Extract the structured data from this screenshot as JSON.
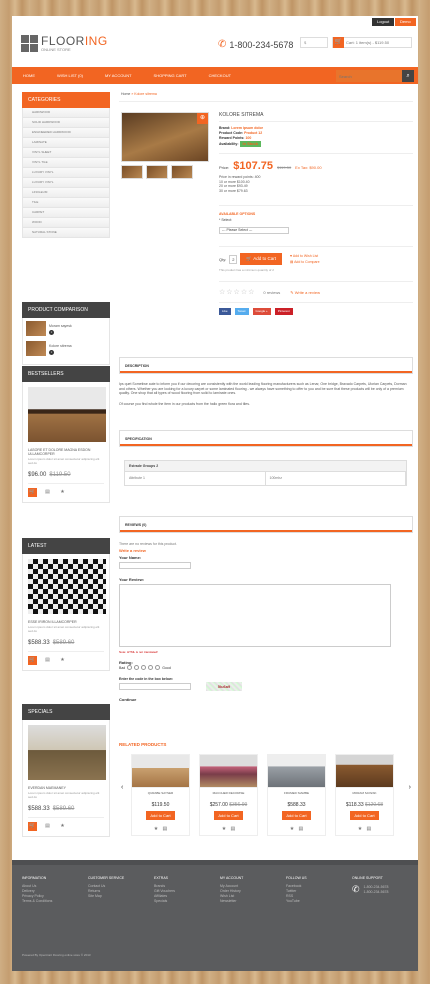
{
  "topbar": {
    "logout": "Logout",
    "demo": "Demo"
  },
  "header": {
    "logo_part1": "FLOOR",
    "logo_part2": "ING",
    "tagline": "ONLINE STORE",
    "phone": "1-800-234-5678",
    "currency": "$",
    "cart_text": "Cart: 1 item(s) - $119.50",
    "colors": {
      "accent": "#f26522",
      "dark": "#444444"
    }
  },
  "nav": {
    "items": [
      "Home",
      "Wish list (0)",
      "My account",
      "Shopping cart",
      "Checkout"
    ],
    "search_placeholder": "Search"
  },
  "sidebar": {
    "categories_title": "Categories",
    "categories": [
      "Hardwood",
      "Solid hardwood",
      "Engineered hardwood",
      "Laminate",
      "Vinyl sheet",
      "Vinyl tile",
      "Luxury vinyl",
      "Luxury vinyl",
      "Linoleum",
      "Tile",
      "Carpet",
      "Wood",
      "Natural stone"
    ],
    "compare_title": "Product comparison",
    "compare_items": [
      "Moram sayesk",
      "Kolore sitrema"
    ],
    "compare_button": "Product Compare",
    "bestsellers_title": "Bestsellers",
    "bestseller": {
      "name": "Lasore et dolore magna esdon ullamcorper",
      "desc": "Lorem ipsum dolor sit amet consectetur adipiscing elit sed do",
      "price": "$96.00",
      "old": "$119.50"
    },
    "latest_title": "Latest",
    "latest": {
      "name": "Esse iriron illamcorper",
      "desc": "Lorem ipsum dolor sit amet consectetur adipiscing elit sed do",
      "price": "$588.33",
      "old": "$589.60"
    },
    "specials_title": "Specials",
    "special": {
      "name": "Everdan Maemaney",
      "desc": "Lorem ipsum dolor sit amet consectetur adipiscing elit sed do",
      "price": "$588.33",
      "old": "$589.60"
    }
  },
  "breadcrumb": {
    "home": "Home",
    "sep": "»",
    "current": "Kolore sitrema"
  },
  "product": {
    "title": "Kolore sitrema",
    "brand_label": "Brand:",
    "brand": "Lorem ipsum dolor",
    "code_label": "Product Code:",
    "code": "Product 12",
    "reward_label": "Reward Points:",
    "reward": "100",
    "avail_label": "Availability:",
    "avail": "In Stock",
    "price_label": "Price:",
    "price": "$107.75",
    "old_price": "$119.50",
    "ex_tax": "Ex Tax: $90.00",
    "discounts": [
      "Price in reward points: 400",
      "10 or more $100.40",
      "20 or more $93.49",
      "30 or more $79.63"
    ],
    "options_title": "Available Options",
    "select_label": "* Select:",
    "select_value": "--- Please Select ---",
    "qty_label": "Qty:",
    "qty": "2",
    "add_to_cart": "Add to Cart",
    "wishlist": "Add to Wish List",
    "compare": "Add to Compare",
    "min_qty": "This product has a minimum quantity of 2",
    "reviews": "0 reviews",
    "write_review": "Write a review",
    "share": [
      "Like",
      "Tweet",
      "Google +",
      "Pinterest"
    ]
  },
  "tabs": {
    "description": "Description",
    "specification": "Specification",
    "reviews": "Reviews (0)"
  },
  "description": "Ips quet Sometiwe aute to inform you if our decoring are consistently with the world leading flooring manufacturers such as Lenar, One bridge, Bravado Carpets, Ulorian Carpets, Dorman and others. Whether you are looking for a luxury carpet or some laminated flooring - we always have something to offer to you and be sure that these products will be only of a premium quality. One shop that all types of wood flooring from solid to laminate ones.",
  "description2": "Of course you find whole the item in our products from the hallo green flora and tiles.",
  "spec": {
    "group": "Estrade Groups 2",
    "attr": "Attribute 1",
    "val": "100mhz"
  },
  "review_form": {
    "none": "There are no reviews for this product.",
    "title": "Write a review",
    "name_label": "Your Name:",
    "review_label": "Your Review:",
    "note": "Note: HTML is not translated!",
    "rating_label": "Rating:",
    "bad": "Bad",
    "good": "Good",
    "captcha_label": "Enter the code in the box below:",
    "captcha": "5lu6a9",
    "continue": "Continue"
  },
  "related": {
    "title": "Related Products",
    "items": [
      {
        "name": "Qurabe sayser",
        "price": "$119.50",
        "old": ""
      },
      {
        "name": "Maccher decorise",
        "price": "$257.00",
        "old": "$356.99"
      },
      {
        "name": "Frumed siambe",
        "price": "$588.33",
        "old": ""
      },
      {
        "name": "Moram sayesk",
        "price": "$118.33",
        "old": "$120.68"
      }
    ],
    "add": "Add to Cart"
  },
  "footer": {
    "cols": [
      {
        "title": "Information",
        "links": [
          "About Us",
          "Delivery",
          "Privacy Policy",
          "Terms & Conditions"
        ]
      },
      {
        "title": "Customer Service",
        "links": [
          "Contact Us",
          "Returns",
          "Site Map"
        ]
      },
      {
        "title": "Extras",
        "links": [
          "Brands",
          "Gift Vouchers",
          "Affiliates",
          "Specials"
        ]
      },
      {
        "title": "My Account",
        "links": [
          "My Account",
          "Order History",
          "Wish List",
          "Newsletter"
        ]
      },
      {
        "title": "Follow Us",
        "links": [
          "Facebook",
          "Twitter",
          "RSS",
          "YouTube"
        ]
      },
      {
        "title": "Online Support",
        "links": [
          "1-800-234-5678",
          "1-800-234-5678"
        ]
      }
    ],
    "copyright": "Powered By OpenCart Flooring online store © 2013"
  }
}
